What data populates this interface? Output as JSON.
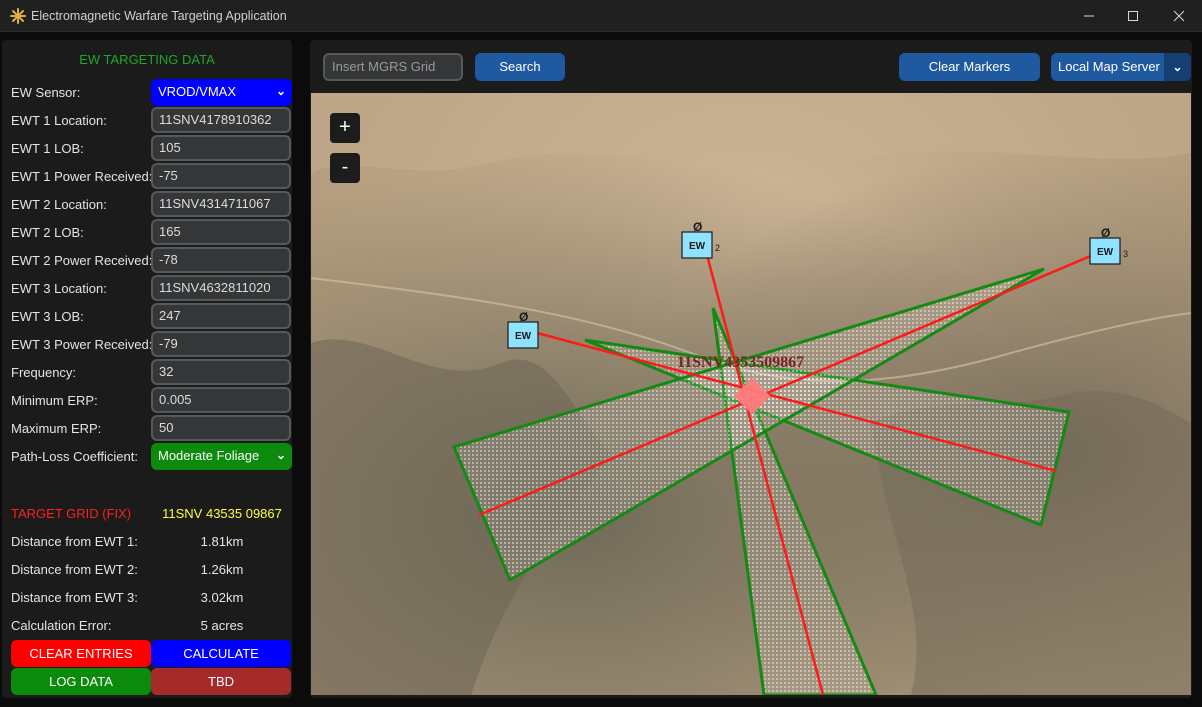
{
  "window": {
    "title": "Electromagnetic Warfare Targeting Application",
    "icon": "sparkle-app-icon",
    "controls": {
      "minimize": "—",
      "maximize": "☐",
      "close": "✕"
    }
  },
  "panel": {
    "title": "EW TARGETING DATA",
    "fields": [
      {
        "label": "EW Sensor:",
        "type": "dropdown",
        "value": "VROD/VMAX",
        "color": "#0000ff"
      },
      {
        "label": "EWT 1 Location:",
        "type": "input",
        "value": "11SNV4178910362"
      },
      {
        "label": "EWT 1 LOB:",
        "type": "input",
        "value": "105"
      },
      {
        "label": "EWT 1 Power Received:",
        "type": "input",
        "value": "-75"
      },
      {
        "label": "EWT 2 Location:",
        "type": "input",
        "value": "11SNV4314711067"
      },
      {
        "label": "EWT 2 LOB:",
        "type": "input",
        "value": "165"
      },
      {
        "label": "EWT 2 Power Received:",
        "type": "input",
        "value": "-78"
      },
      {
        "label": "EWT 3 Location:",
        "type": "input",
        "value": "11SNV4632811020"
      },
      {
        "label": "EWT 3 LOB:",
        "type": "input",
        "value": "247"
      },
      {
        "label": "EWT 3 Power Received:",
        "type": "input",
        "value": "-79"
      },
      {
        "label": "Frequency:",
        "type": "input",
        "value": "32"
      },
      {
        "label": "Minimum ERP:",
        "type": "input",
        "value": "0.005"
      },
      {
        "label": "Maximum ERP:",
        "type": "input",
        "value": "50"
      },
      {
        "label": "Path-Loss Coefficient:",
        "type": "dropdown",
        "value": "Moderate Foliage",
        "color": "#0c8a0c"
      }
    ],
    "results": {
      "target_label": "TARGET GRID (FIX)",
      "target_value": "11SNV 43535 09867",
      "rows": [
        {
          "label": "Distance from EWT 1:",
          "value": "1.81km"
        },
        {
          "label": "Distance from EWT 2:",
          "value": "1.26km"
        },
        {
          "label": "Distance from EWT 3:",
          "value": "3.02km"
        },
        {
          "label": "Calculation Error:",
          "value": "5 acres"
        }
      ]
    },
    "buttons": {
      "clear": "CLEAR ENTRIES",
      "calculate": "CALCULATE",
      "log": "LOG DATA",
      "tbd": "TBD"
    }
  },
  "map": {
    "search_placeholder": "Insert MGRS Grid",
    "search_label": "Search",
    "clear_markers_label": "Clear Markers",
    "server_selected": "Local Map Server",
    "zoom_in": "+",
    "zoom_out": "-",
    "target_label": "11SNV4353509867",
    "sensors": [
      {
        "label": "EW",
        "number": "",
        "antenna": "Ø"
      },
      {
        "label": "EW",
        "number": "2",
        "antenna": "Ø"
      },
      {
        "label": "EW",
        "number": "3",
        "antenna": "Ø"
      }
    ],
    "colors": {
      "lob_line": "#ff1a1a",
      "sector_outline": "#138a13",
      "sensor_fill": "#8fe3ff",
      "target_marker": "#ff7b7b"
    }
  }
}
